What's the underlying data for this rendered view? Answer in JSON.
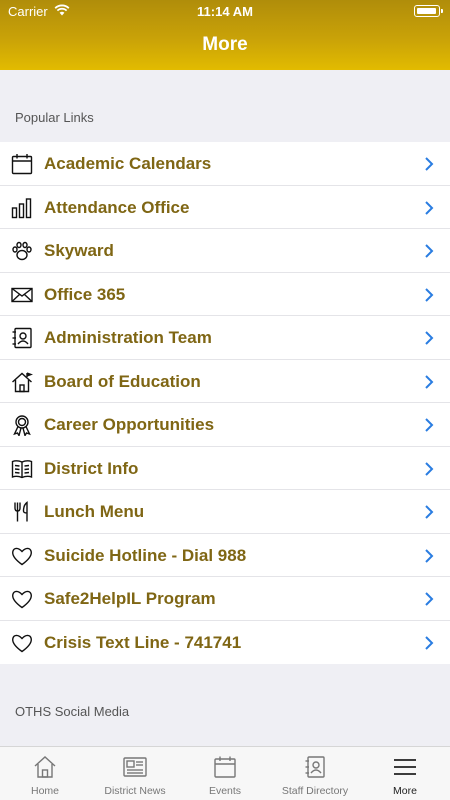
{
  "status": {
    "carrier": "Carrier",
    "time": "11:14 AM"
  },
  "header": {
    "title": "More"
  },
  "sections": {
    "popular_title": "Popular Links",
    "social_title": "OTHS Social Media"
  },
  "links": [
    {
      "label": "Academic Calendars",
      "icon": "calendar-icon"
    },
    {
      "label": "Attendance Office",
      "icon": "bar-chart-icon"
    },
    {
      "label": "Skyward",
      "icon": "paw-icon"
    },
    {
      "label": "Office 365",
      "icon": "envelope-icon"
    },
    {
      "label": "Administration Team",
      "icon": "contact-card-icon"
    },
    {
      "label": "Board of Education",
      "icon": "house-icon"
    },
    {
      "label": "Career Opportunities",
      "icon": "ribbon-icon"
    },
    {
      "label": "District Info",
      "icon": "book-icon"
    },
    {
      "label": "Lunch Menu",
      "icon": "utensils-icon"
    },
    {
      "label": "Suicide Hotline - Dial 988",
      "icon": "heart-icon"
    },
    {
      "label": "Safe2HelpIL Program",
      "icon": "heart-icon"
    },
    {
      "label": "Crisis Text Line - 741741",
      "icon": "heart-icon"
    }
  ],
  "tabs": [
    {
      "label": "Home",
      "icon": "home-icon"
    },
    {
      "label": "District News",
      "icon": "newspaper-icon"
    },
    {
      "label": "Events",
      "icon": "calendar-icon"
    },
    {
      "label": "Staff Directory",
      "icon": "contact-card-icon"
    },
    {
      "label": "More",
      "icon": "menu-icon",
      "active": true
    }
  ],
  "colors": {
    "header_gold": "#c9a208",
    "link_text": "#7f6614",
    "chevron": "#2a7de1"
  }
}
